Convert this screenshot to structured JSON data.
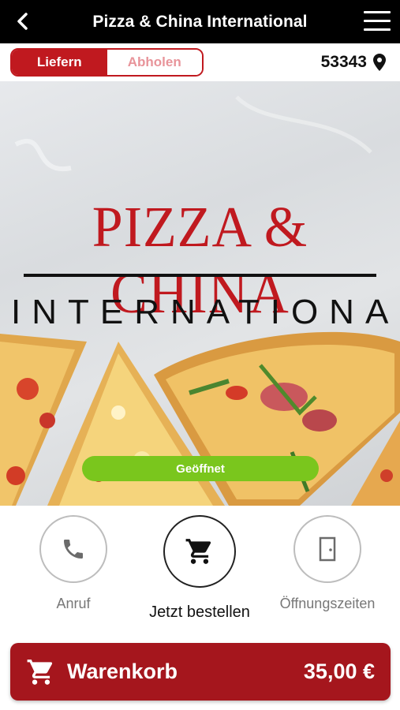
{
  "header": {
    "title": "Pizza & China International",
    "back_icon": "chevron-left-icon",
    "menu_icon": "hamburger-menu-icon"
  },
  "order_mode": {
    "options": [
      "Liefern",
      "Abholen"
    ],
    "selected": "Liefern",
    "postal_code": "53343",
    "location_icon": "map-pin-icon"
  },
  "hero": {
    "brand_line1": "PIZZA & CHINA",
    "brand_line2": "INTERNATIONAL",
    "status": "Geöffnet"
  },
  "actions": {
    "call_label": "Anruf",
    "order_label": "Jetzt bestellen",
    "hours_label": "Öffnungszeiten"
  },
  "cart": {
    "label": "Warenkorb",
    "total": "35,00 €"
  },
  "colors": {
    "brand_red": "#c0191f",
    "cart_red": "#a5161d",
    "open_green": "#7ac61d",
    "header_black": "#000000"
  }
}
